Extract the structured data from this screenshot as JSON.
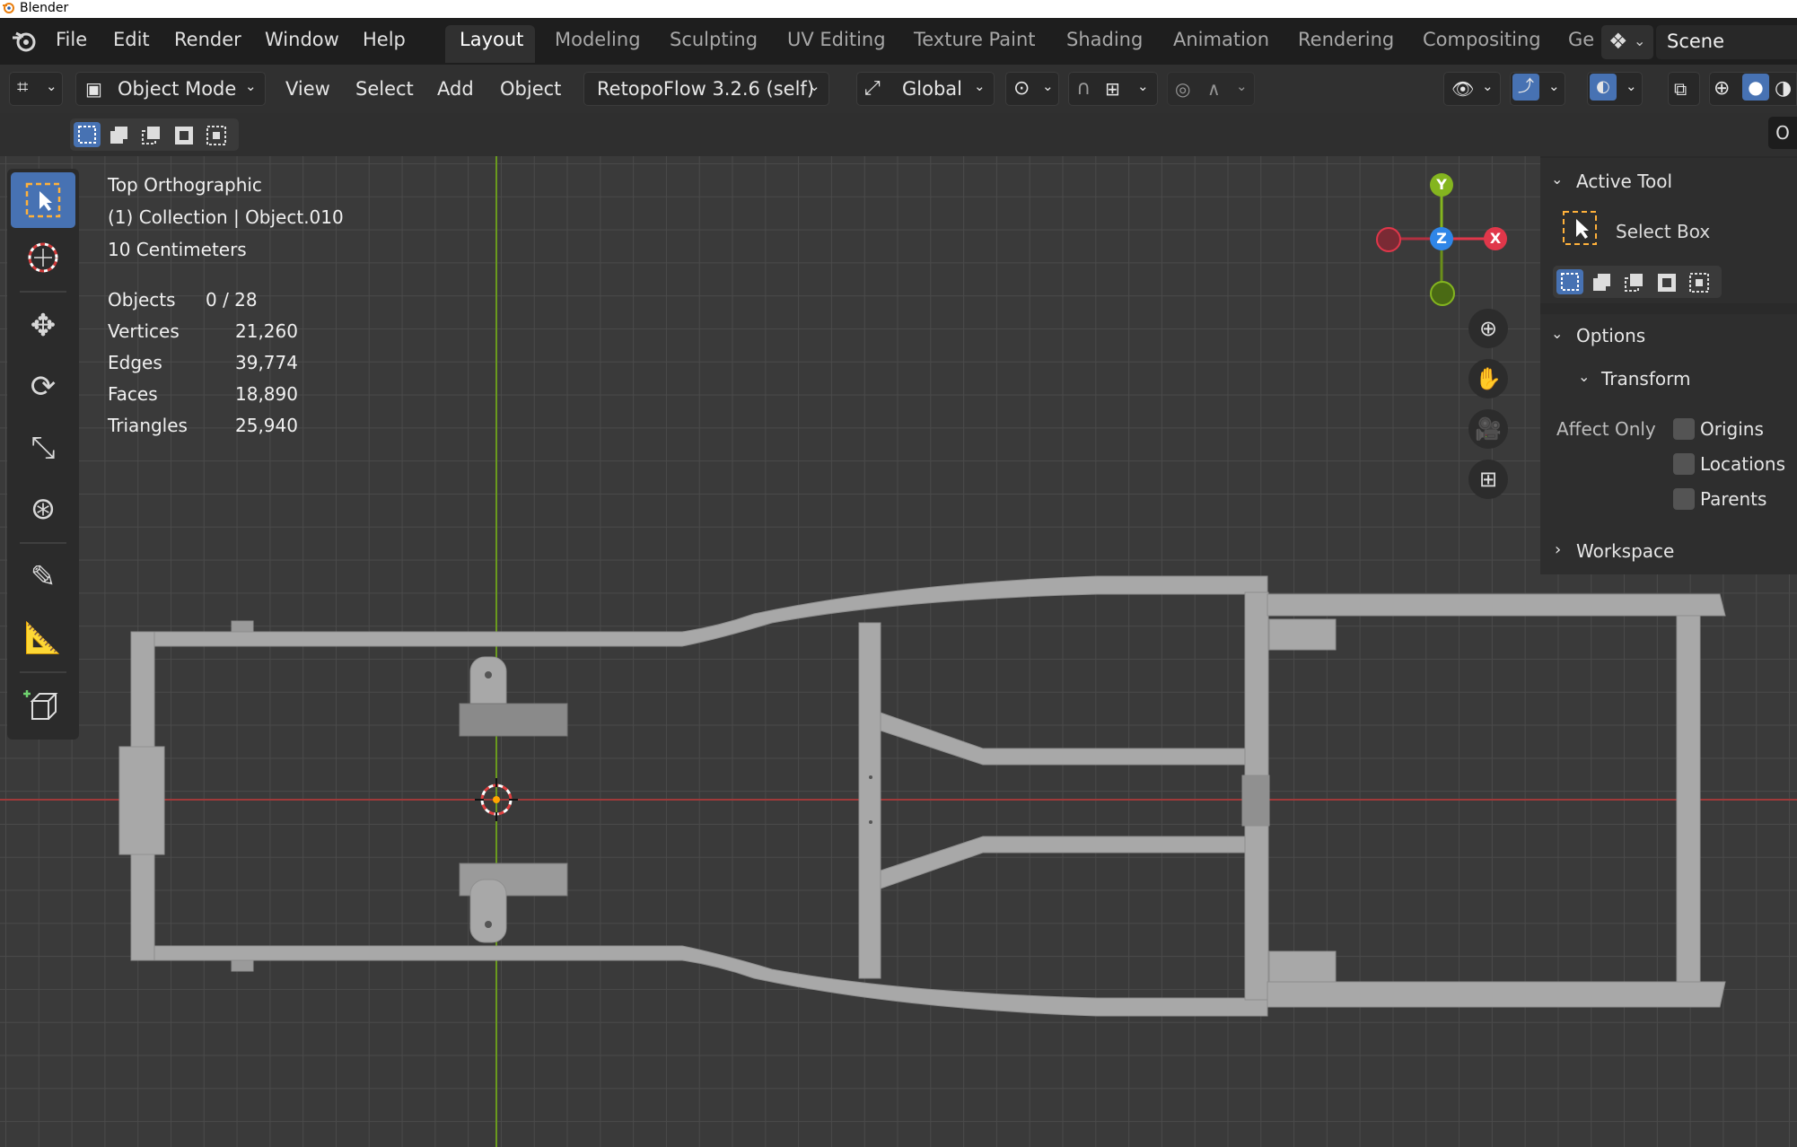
{
  "window": {
    "title": "Blender"
  },
  "topbar": {
    "menus": [
      "File",
      "Edit",
      "Render",
      "Window",
      "Help"
    ],
    "workspaces": [
      "Layout",
      "Modeling",
      "Sculpting",
      "UV Editing",
      "Texture Paint",
      "Shading",
      "Animation",
      "Rendering",
      "Compositing",
      "Ge"
    ],
    "active_workspace": "Layout",
    "scene": "Scene"
  },
  "header": {
    "mode": "Object Mode",
    "menus": [
      "View",
      "Select",
      "Add",
      "Object"
    ],
    "addon": "RetopoFlow 3.2.6 (self)",
    "orientation": "Global"
  },
  "overlay": {
    "view_name": "Top Orthographic",
    "collection": "(1) Collection | Object.010",
    "scale": "10 Centimeters",
    "stats": [
      {
        "label": "Objects",
        "value": "0 / 28"
      },
      {
        "label": "Vertices",
        "value": "21,260"
      },
      {
        "label": "Edges",
        "value": "39,774"
      },
      {
        "label": "Faces",
        "value": "18,890"
      },
      {
        "label": "Triangles",
        "value": "25,940"
      }
    ]
  },
  "gizmo": {
    "y": "Y",
    "z": "Z",
    "x": "X"
  },
  "npanel": {
    "tab_letter": "O",
    "active_tool_title": "Active Tool",
    "tool_name": "Select Box",
    "options_title": "Options",
    "transform_title": "Transform",
    "affect_only": "Affect Only",
    "checks": [
      "Origins",
      "Locations",
      "Parents"
    ],
    "workspace_title": "Workspace"
  },
  "colors": {
    "accent": "#4772b3",
    "axis_x": "#a03a3a",
    "axis_y": "#6a9a1e",
    "frame": "#a8a8a8",
    "gizmo_x": "#e0374a",
    "gizmo_y": "#84b51f",
    "gizmo_z": "#2f86e8"
  }
}
